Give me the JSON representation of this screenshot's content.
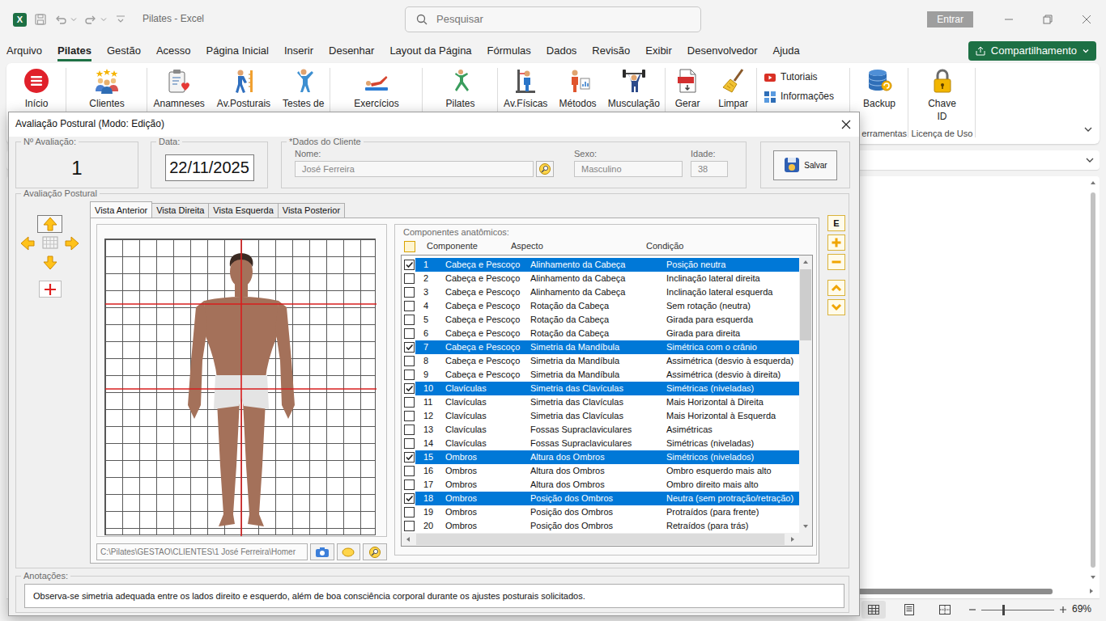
{
  "window": {
    "app_icon": "X",
    "title": "Pilates - Excel"
  },
  "search": {
    "placeholder": "Pesquisar"
  },
  "account": {
    "signin": "Entrar"
  },
  "menu": [
    {
      "label": "Arquivo",
      "selected": false
    },
    {
      "label": "Pilates",
      "selected": true
    },
    {
      "label": "Gestão",
      "selected": false
    },
    {
      "label": "Acesso",
      "selected": false
    },
    {
      "label": "Página Inicial",
      "selected": false
    },
    {
      "label": "Inserir",
      "selected": false
    },
    {
      "label": "Desenhar",
      "selected": false
    },
    {
      "label": "Layout da Página",
      "selected": false
    },
    {
      "label": "Fórmulas",
      "selected": false
    },
    {
      "label": "Dados",
      "selected": false
    },
    {
      "label": "Revisão",
      "selected": false
    },
    {
      "label": "Exibir",
      "selected": false
    },
    {
      "label": "Desenvolvedor",
      "selected": false
    },
    {
      "label": "Ajuda",
      "selected": false
    }
  ],
  "share": {
    "label": "Compartilhamento"
  },
  "ribbon": {
    "groups": [
      {
        "buttons": [
          {
            "label": "Início"
          }
        ]
      },
      {
        "buttons": [
          {
            "label": "Clientes"
          }
        ]
      },
      {
        "buttons": [
          {
            "label": "Anamneses"
          },
          {
            "label": "Av.Posturais"
          },
          {
            "label": "Testes de"
          }
        ]
      },
      {
        "buttons": [
          {
            "label": "Exercícios"
          }
        ]
      },
      {
        "buttons": [
          {
            "label": "Pilates"
          }
        ]
      },
      {
        "buttons": [
          {
            "label": "Av.Físicas"
          },
          {
            "label": "Métodos"
          },
          {
            "label": "Musculação"
          }
        ]
      },
      {
        "buttons": [
          {
            "label": "Gerar"
          },
          {
            "label": "Limpar"
          }
        ]
      },
      {
        "small_buttons": [
          {
            "label": "Tutoriais"
          },
          {
            "label": "Informações"
          }
        ]
      },
      {
        "label": "erramentas",
        "buttons": [
          {
            "label": "Backup"
          }
        ]
      },
      {
        "label": "Licença de Uso",
        "buttons": [
          {
            "label": "Chave ID"
          }
        ]
      }
    ]
  },
  "dialog": {
    "title": "Avaliação Postural (Modo: Edição)",
    "evaluation": {
      "label": "Nº Avaliação:",
      "value": "1"
    },
    "date": {
      "label": "Data:",
      "value": "22/11/2025"
    },
    "client": {
      "label": "*Dados do Cliente",
      "name_label": "Nome:",
      "name": "José Ferreira",
      "sex_label": "Sexo:",
      "sex": "Masculino",
      "age_label": "Idade:",
      "age": "38",
      "disabled": true
    },
    "save_button": "Salvar",
    "postural": {
      "label": "Avaliação Postural",
      "pad": [
        {
          "selected": true
        },
        {
          "selected": false
        },
        {
          "selected": false
        },
        {
          "selected": false
        },
        {
          "selected": false
        }
      ],
      "tabs": [
        {
          "label": "Vista Anterior",
          "selected": true
        },
        {
          "label": "Vista Direita",
          "selected": false
        },
        {
          "label": "Vista Esquerda",
          "selected": false
        },
        {
          "label": "Vista Posterior",
          "selected": false
        }
      ],
      "image_path": "C:\\Pilates\\GESTAO\\CLIENTES\\1 José Ferreira\\Homer",
      "components_label": "Componentes anatômicos:",
      "columns": [
        "Componente",
        "Aspecto",
        "Condição"
      ],
      "rows": [
        {
          "number": "1",
          "component": "Cabeça e Pescoço",
          "aspect": "Alinhamento da Cabeça",
          "condition": "Posição neutra",
          "checked": true
        },
        {
          "number": "2",
          "component": "Cabeça e Pescoço",
          "aspect": "Alinhamento da Cabeça",
          "condition": "Inclinação lateral direita",
          "checked": false
        },
        {
          "number": "3",
          "component": "Cabeça e Pescoço",
          "aspect": "Alinhamento da Cabeça",
          "condition": "Inclinação lateral esquerda",
          "checked": false
        },
        {
          "number": "4",
          "component": "Cabeça e Pescoço",
          "aspect": "Rotação da Cabeça",
          "condition": "Sem rotação (neutra)",
          "checked": false
        },
        {
          "number": "5",
          "component": "Cabeça e Pescoço",
          "aspect": "Rotação da Cabeça",
          "condition": "Girada para esquerda",
          "checked": false
        },
        {
          "number": "6",
          "component": "Cabeça e Pescoço",
          "aspect": "Rotação da Cabeça",
          "condition": "Girada para direita",
          "checked": false
        },
        {
          "number": "7",
          "component": "Cabeça e Pescoço",
          "aspect": "Simetria da Mandíbula",
          "condition": "Simétrica com o crânio",
          "checked": true
        },
        {
          "number": "8",
          "component": "Cabeça e Pescoço",
          "aspect": "Simetria da Mandíbula",
          "condition": "Assimétrica (desvio à esquerda)",
          "checked": false
        },
        {
          "number": "9",
          "component": "Cabeça e Pescoço",
          "aspect": "Simetria da Mandíbula",
          "condition": "Assimétrica (desvio à direita)",
          "checked": false
        },
        {
          "number": "10",
          "component": "Clavículas",
          "aspect": "Simetria das Clavículas",
          "condition": "Simétricas (niveladas)",
          "checked": true
        },
        {
          "number": "11",
          "component": "Clavículas",
          "aspect": "Simetria das Clavículas",
          "condition": "Mais Horizontal à Direita",
          "checked": false
        },
        {
          "number": "12",
          "component": "Clavículas",
          "aspect": "Simetria das Clavículas",
          "condition": "Mais Horizontal à Esquerda",
          "checked": false
        },
        {
          "number": "13",
          "component": "Clavículas",
          "aspect": "Fossas Supraclaviculares",
          "condition": "Asimétricas",
          "checked": false
        },
        {
          "number": "14",
          "component": "Clavículas",
          "aspect": "Fossas Supraclaviculares",
          "condition": "Simétricas (niveladas)",
          "checked": false
        },
        {
          "number": "15",
          "component": "Ombros",
          "aspect": "Altura dos Ombros",
          "condition": "Simétricos (nivelados)",
          "checked": true
        },
        {
          "number": "16",
          "component": "Ombros",
          "aspect": "Altura dos Ombros",
          "condition": "Ombro esquerdo mais alto",
          "checked": false
        },
        {
          "number": "17",
          "component": "Ombros",
          "aspect": "Altura dos Ombros",
          "condition": "Ombro direito mais alto",
          "checked": false
        },
        {
          "number": "18",
          "component": "Ombros",
          "aspect": "Posição dos Ombros",
          "condition": "Neutra (sem protração/retração)",
          "checked": true
        },
        {
          "number": "19",
          "component": "Ombros",
          "aspect": "Posição dos Ombros",
          "condition": "Protraídos (para frente)",
          "checked": false
        },
        {
          "number": "20",
          "component": "Ombros",
          "aspect": "Posição dos Ombros",
          "condition": "Retraídos (para trás)",
          "checked": false
        }
      ],
      "side_buttons": {
        "edit": "E"
      }
    },
    "notes": {
      "label": "Anotações:",
      "text": "Observa-se simetria adequada entre os lados direito e esquerdo, além de boa consciência corporal durante os ajustes posturais solicitados."
    }
  },
  "status_bar": {
    "views": [
      {
        "selected": true
      },
      {
        "selected": false
      },
      {
        "selected": false
      }
    ],
    "zoom": "69%",
    "zoom_level": 0.3
  }
}
